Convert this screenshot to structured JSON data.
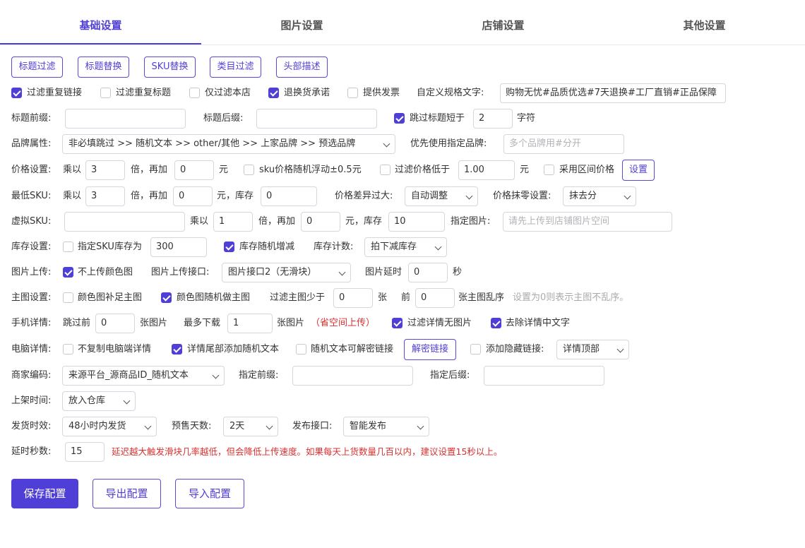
{
  "tabs": [
    "基础设置",
    "图片设置",
    "店铺设置",
    "其他设置"
  ],
  "filter_buttons": [
    "标题过滤",
    "标题替换",
    "SKU替换",
    "类目过滤",
    "头部描述"
  ],
  "row1": {
    "dedupe_links": "过滤重复链接",
    "dedupe_links_checked": true,
    "dedupe_titles": "过滤重复标题",
    "dedupe_titles_checked": false,
    "this_shop_only": "仅过滤本店",
    "this_shop_only_checked": false,
    "return_promise": "退换货承诺",
    "return_promise_checked": true,
    "invoice": "提供发票",
    "invoice_checked": false,
    "spec_text_label": "自定义规格文字:",
    "spec_text_value": "购物无忧#品质优选#7天退换#工厂直销#正品保障"
  },
  "row2": {
    "prefix_label": "标题前缀:",
    "suffix_label": "标题后缀:",
    "skip_short": "跳过标题短于",
    "skip_short_checked": true,
    "skip_short_value": "2",
    "unit_chars": "字符"
  },
  "row3": {
    "brand_label": "品牌属性:",
    "brand_value": "非必填跳过 >> 随机文本 >> other/其他 >> 上家品牌 >> 预选品牌",
    "prefer_brand_label": "优先使用指定品牌:",
    "prefer_brand_placeholder": "多个品牌用#分开"
  },
  "row4": {
    "label": "价格设置:",
    "mul": "乘以",
    "mul_value": "3",
    "times_add": "倍，再加",
    "add_value": "0",
    "yuan": "元",
    "sku_float": "sku价格随机浮动±0.5元",
    "sku_float_checked": false,
    "filter_low": "过滤价格低于",
    "filter_low_checked": false,
    "filter_low_value": "1.00",
    "yuan2": "元",
    "range_price": "采用区间价格",
    "range_price_checked": false,
    "settings_btn": "设置"
  },
  "row5": {
    "label": "最低SKU:",
    "mul": "乘以",
    "mul_value": "3",
    "times_add": "倍，再加",
    "add_value": "0",
    "yuan_stock": "元，库存",
    "stock_value": "0",
    "diff_label": "价格差异过大:",
    "diff_value": "自动调整",
    "round_label": "价格抹零设置:",
    "round_value": "抹去分"
  },
  "row6": {
    "label": "虚拟SKU:",
    "mul": "乘以",
    "mul_value": "1",
    "times_add": "倍，再加",
    "add_value": "0",
    "yuan_stock": "元，库存",
    "stock_value": "10",
    "image_label": "指定图片:",
    "image_placeholder": "请先上传到店铺图片空间"
  },
  "row7": {
    "label": "库存设置:",
    "fixed": "指定SKU库存为",
    "fixed_checked": false,
    "fixed_value": "300",
    "random": "库存随机增减",
    "random_checked": true,
    "count_label": "库存计数:",
    "count_value": "拍下减库存"
  },
  "row8": {
    "label": "图片上传:",
    "no_color": "不上传颜色图",
    "no_color_checked": true,
    "api_label": "图片上传接口:",
    "api_value": "图片接口2（无滑块）",
    "delay_label": "图片延时",
    "delay_value": "0",
    "sec": "秒"
  },
  "row9": {
    "label": "主图设置:",
    "fill": "颜色图补足主图",
    "fill_checked": false,
    "random_main": "颜色图随机做主图",
    "random_main_checked": true,
    "less_label": "过滤主图少于",
    "less_value": "0",
    "zhang": "张",
    "front": "前",
    "front_value": "0",
    "shuffle": "张主图乱序",
    "hint": "设置为0则表示主图不乱序。"
  },
  "row10": {
    "label": "手机详情:",
    "skip": "跳过前",
    "skip_value": "0",
    "zhang_img": "张图片",
    "max_label": "最多下载",
    "max_value": "1",
    "zhang_img2": "张图片",
    "save_space": "（省空间上传）",
    "no_img": "过滤详情无图片",
    "no_img_checked": true,
    "remove_text": "去除详情中文字",
    "remove_text_checked": true
  },
  "row11": {
    "label": "电脑详情:",
    "no_copy": "不复制电脑端详情",
    "no_copy_checked": false,
    "tail_random": "详情尾部添加随机文本",
    "tail_random_checked": true,
    "decrypt": "随机文本可解密链接",
    "decrypt_checked": false,
    "decrypt_btn": "解密链接",
    "hidden": "添加隐藏链接:",
    "hidden_checked": false,
    "hidden_value": "详情顶部"
  },
  "row12": {
    "label": "商家编码:",
    "value": "来源平台_源商品ID_随机文本",
    "prefix_label": "指定前缀:",
    "suffix_label": "指定后缀:"
  },
  "row13": {
    "label": "上架时间:",
    "value": "放入仓库"
  },
  "row14": {
    "label": "发货时效:",
    "value": "48小时内发货",
    "presale_label": "预售天数:",
    "presale_value": "2天",
    "api_label": "发布接口:",
    "api_value": "智能发布"
  },
  "row15": {
    "label": "延时秒数:",
    "value": "15",
    "warning": "延迟越大触发滑块几率越低，但会降低上传速度。如果每天上货数量几百以内，建议设置15秒以上。"
  },
  "actions": {
    "save": "保存配置",
    "export": "导出配置",
    "import": "导入配置"
  },
  "colors": {
    "accent": "#4f3fd6",
    "warning": "#d9302f"
  }
}
